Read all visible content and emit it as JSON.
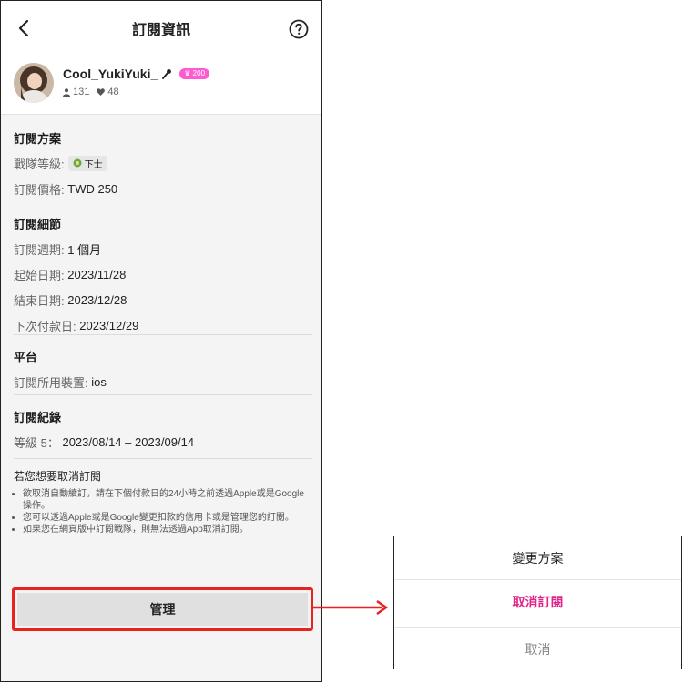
{
  "header": {
    "title": "訂閱資訊"
  },
  "profile": {
    "name": "Cool_YukiYuki_",
    "level_badge": "200",
    "followers": "131",
    "likes": "48"
  },
  "plan": {
    "title": "訂閱方案",
    "rank_label": "戰隊等級:",
    "rank_value": "下士",
    "price_label": "訂閱價格:",
    "price_value": "TWD 250"
  },
  "details": {
    "title": "訂閱細節",
    "period_label": "訂閱週期:",
    "period_value": "1 個月",
    "start_label": "起始日期:",
    "start_value": "2023/11/28",
    "end_label": "結束日期:",
    "end_value": "2023/12/28",
    "next_label": "下次付款日:",
    "next_value": "2023/12/29"
  },
  "platform": {
    "title": "平台",
    "device_label": "訂閱所用裝置:",
    "device_value": "ios"
  },
  "history": {
    "title": "訂閱紀錄",
    "level_label": "等級 5：",
    "level_range": "2023/08/14 – 2023/09/14"
  },
  "cancel_info": {
    "title": "若您想要取消訂閱",
    "notes": [
      "欲取消自動續訂，請在下個付款日的24小時之前透過Apple或是Google操作。",
      "您可以透過Apple或是Google變更扣款的信用卡或是管理您的訂閱。",
      "如果您在網頁版中訂閱戰隊，則無法透過App取消訂閱。"
    ]
  },
  "manage_button": "管理",
  "action_sheet": {
    "change_plan": "變更方案",
    "cancel_subscription": "取消訂閱",
    "cancel": "取消"
  },
  "colors": {
    "accent_pink": "#e0238a",
    "badge_pink": "#ff5bd0",
    "highlight_red": "#e8231d"
  }
}
